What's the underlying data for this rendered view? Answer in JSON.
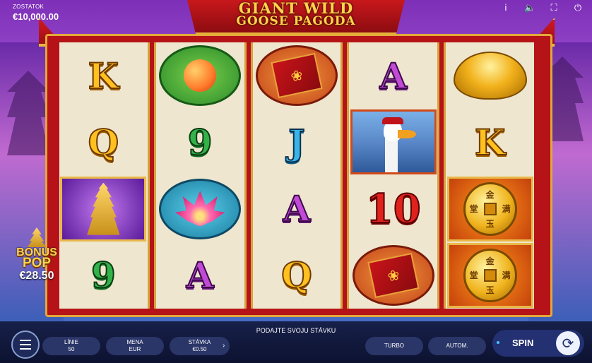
{
  "hud": {
    "balance_label": "ZOSTATOK",
    "balance_value": "€10,000.00",
    "icons": [
      "info-icon",
      "sound-icon",
      "fullscreen-icon",
      "power-icon"
    ]
  },
  "title": {
    "line1": "GIANT WILD",
    "line2": "GOOSE PAGODA"
  },
  "reels": [
    [
      "K",
      "Q",
      "pagoda",
      "9"
    ],
    [
      "peach",
      "9",
      "lotus",
      "A"
    ],
    [
      "envelope",
      "J",
      "A",
      "Q"
    ],
    [
      "A",
      "goose",
      "10",
      "envelope"
    ],
    [
      "ingot",
      "K",
      "coin",
      "coin"
    ]
  ],
  "bonus": {
    "line1": "BONUS",
    "line2": "POP",
    "amount": "€28.50"
  },
  "controls": {
    "prompt": "PODAJTE SVOJU STÁVKU",
    "lines_label": "LÍNIE",
    "lines_value": "50",
    "currency_label": "MENA",
    "currency_value": "EUR",
    "bet_label": "STÁVKA",
    "bet_value": "€0.50",
    "turbo": "TURBO",
    "auto": "AUTOM.",
    "spin": "SPIN"
  },
  "colors": {
    "frame": "#b51318",
    "gold": "#e2a83a",
    "reel_bg": "#efe6cf",
    "bar": "#17204a"
  }
}
